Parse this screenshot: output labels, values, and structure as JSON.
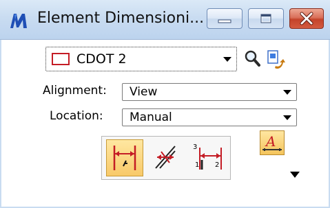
{
  "window": {
    "title": "Element Dimensioni...",
    "buttons": [
      "minimize",
      "maximize",
      "close"
    ]
  },
  "style_dropdown": {
    "value": "CDOT 2",
    "swatch_color": "#c41c25"
  },
  "alignment": {
    "label": "Alignment:",
    "value": "View"
  },
  "location": {
    "label": "Location:",
    "value": "Manual"
  },
  "tools": [
    {
      "name": "dimension-size-arrow",
      "active": true
    },
    {
      "name": "dimension-angle",
      "active": false
    },
    {
      "name": "dimension-ordinate",
      "active": false
    }
  ],
  "ordinate_digits": [
    "3",
    "1",
    "2"
  ],
  "colors": {
    "titlebar": "#c9dcf1",
    "close": "#c4432a",
    "accent": "#f8c969",
    "tool_red": "#c41c25"
  }
}
